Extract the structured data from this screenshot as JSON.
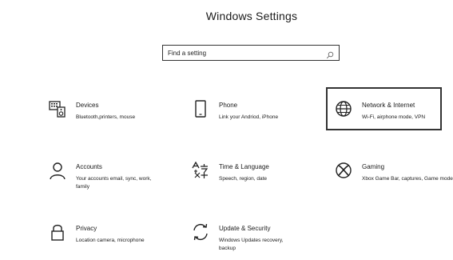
{
  "header": {
    "title": "Windows Settings"
  },
  "search": {
    "placeholder": "Find a setting"
  },
  "tiles": [
    {
      "name": "Devices",
      "description": "Bluetooth,printers, mouse",
      "icon": "devices-icon"
    },
    {
      "name": "Phone",
      "description": "Link your Andriod, iPhone",
      "icon": "phone-icon"
    },
    {
      "name": "Network & Internet",
      "description": "Wi-Fi, airphone mode, VPN",
      "icon": "globe-icon"
    },
    {
      "name": "Accounts",
      "description": "Your accounts email, sync, work, family",
      "icon": "person-icon"
    },
    {
      "name": "Time & Language",
      "description": "Speech, region, date",
      "icon": "language-icon"
    },
    {
      "name": "Gaming",
      "description": "Xbox Game Bar, captures, Game mode",
      "icon": "xbox-icon"
    },
    {
      "name": "Privacy",
      "description": "Location camera, microphone",
      "icon": "lock-icon"
    },
    {
      "name": "Update & Security",
      "description": "Windows Updates recovery, backup",
      "icon": "sync-icon"
    }
  ],
  "selected_tile": "Network & Internet"
}
